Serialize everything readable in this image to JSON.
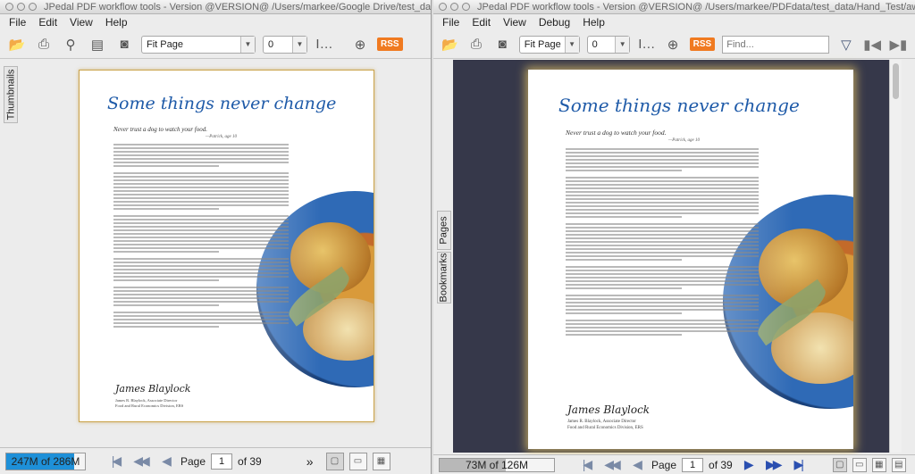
{
  "left": {
    "title": "JPedal PDF workflow tools - Version @VERSION@ /Users/markee/Google Drive/test_da...",
    "menu": [
      "File",
      "Edit",
      "View",
      "Help"
    ],
    "zoom": "Fit Page",
    "rotation": "0",
    "rss": "RSS",
    "sidetab": "Thumbnails",
    "memory": "247M of 286M",
    "memory_fraction": 0.864,
    "page_label": "Page",
    "page_value": "1",
    "page_total": "of 39",
    "more": "»"
  },
  "right": {
    "title": "JPedal PDF workflow tools - Version @VERSION@ /Users/markee/PDFdata/test_data/Hand_Test/awjune...",
    "menu": [
      "File",
      "Edit",
      "View",
      "Debug",
      "Help"
    ],
    "zoom": "Fit Page",
    "rotation": "0",
    "rss": "RSS",
    "find_placeholder": "Find...",
    "sidetab_pages": "Pages",
    "sidetab_bookmarks": "Bookmarks",
    "memory": "73M of 126M",
    "memory_fraction": 0.579,
    "page_label": "Page",
    "page_value": "1",
    "page_total": "of 39"
  },
  "document": {
    "heading": "Some things never change",
    "quote": "Never trust a dog to watch your food.",
    "cite": "—Patrick, age 10",
    "signature": "James Blaylock",
    "sig_line1": "James R. Blaylock, Associate Director",
    "sig_line2": "Food and Rural Economics Division, ERS"
  },
  "colors": {
    "accent_blue": "#1e5aa8",
    "memory_fill": "#1e90d8",
    "rss": "#f07a20",
    "viewer_bg": "#36384a"
  }
}
